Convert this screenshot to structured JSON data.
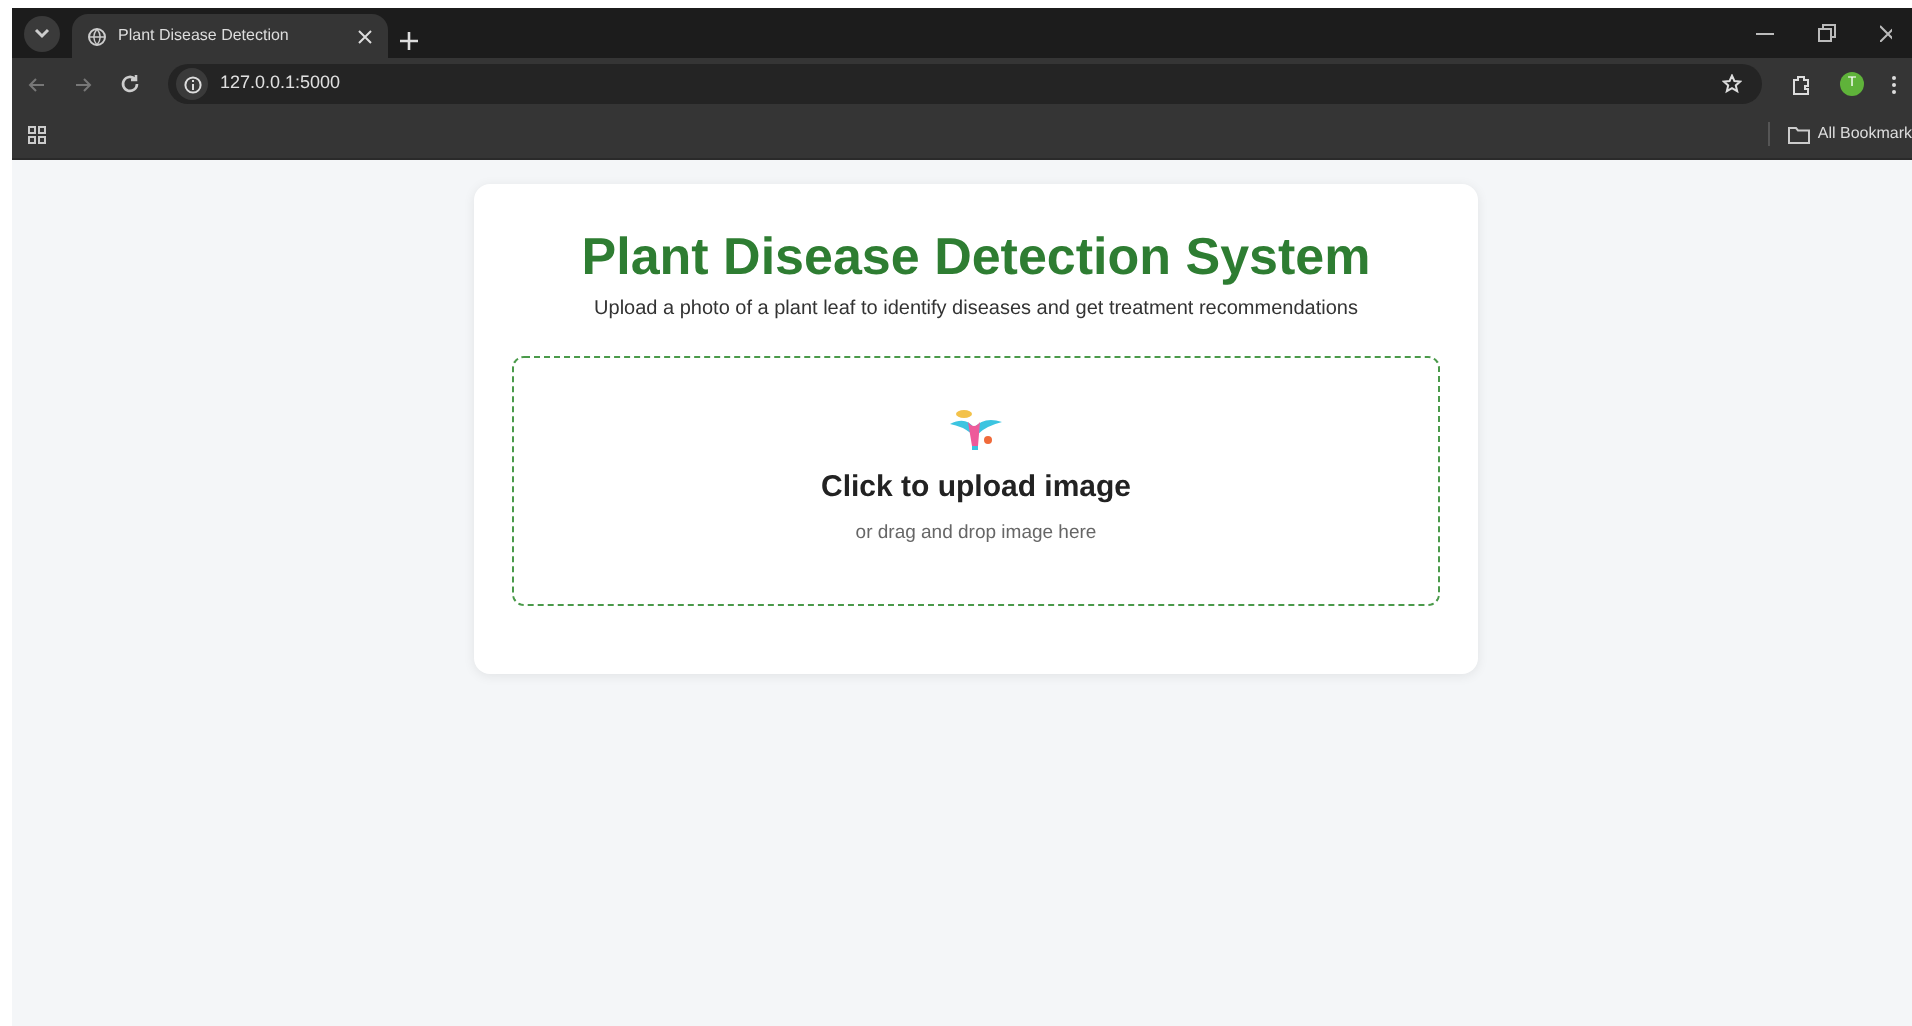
{
  "browser": {
    "tabs": [
      {
        "title": "Plant Disease Detection",
        "selected": true
      }
    ],
    "url": "127.0.0.1:5000",
    "profile_initial": "T",
    "bookmarks_label": "All Bookmark"
  },
  "page": {
    "title": "Plant Disease Detection System",
    "subtitle": "Upload a photo of a plant leaf to identify diseases and get treatment recommendations",
    "upload": {
      "heading": "Click to upload image",
      "hint": "or drag and drop image here"
    }
  }
}
